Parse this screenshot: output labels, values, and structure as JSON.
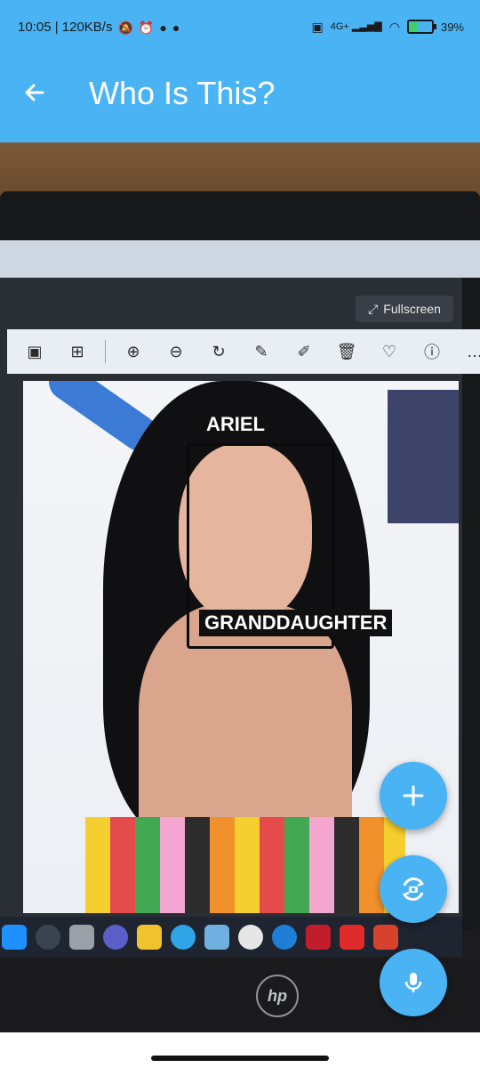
{
  "status_bar": {
    "time_speed": "10:05 | 120KB/s",
    "network": "4G+",
    "battery": "39%",
    "battery_level": 0.39
  },
  "header": {
    "title": "Who Is This?",
    "back_icon": "arrow-left-icon"
  },
  "photo_overlay": {
    "fullscreen_label": "Fullscreen",
    "face_labels": {
      "top": "ARIEL",
      "bottom": "GRANDDAUGHTER"
    }
  },
  "fabs": [
    {
      "icon": "plus-icon",
      "name": "add"
    },
    {
      "icon": "camera-rotate-icon",
      "name": "switch-camera"
    },
    {
      "icon": "microphone-icon",
      "name": "voice"
    }
  ],
  "colors": {
    "primary": "#4ab3f3",
    "label_bg": "#101010",
    "label_text": "#ffffff"
  }
}
